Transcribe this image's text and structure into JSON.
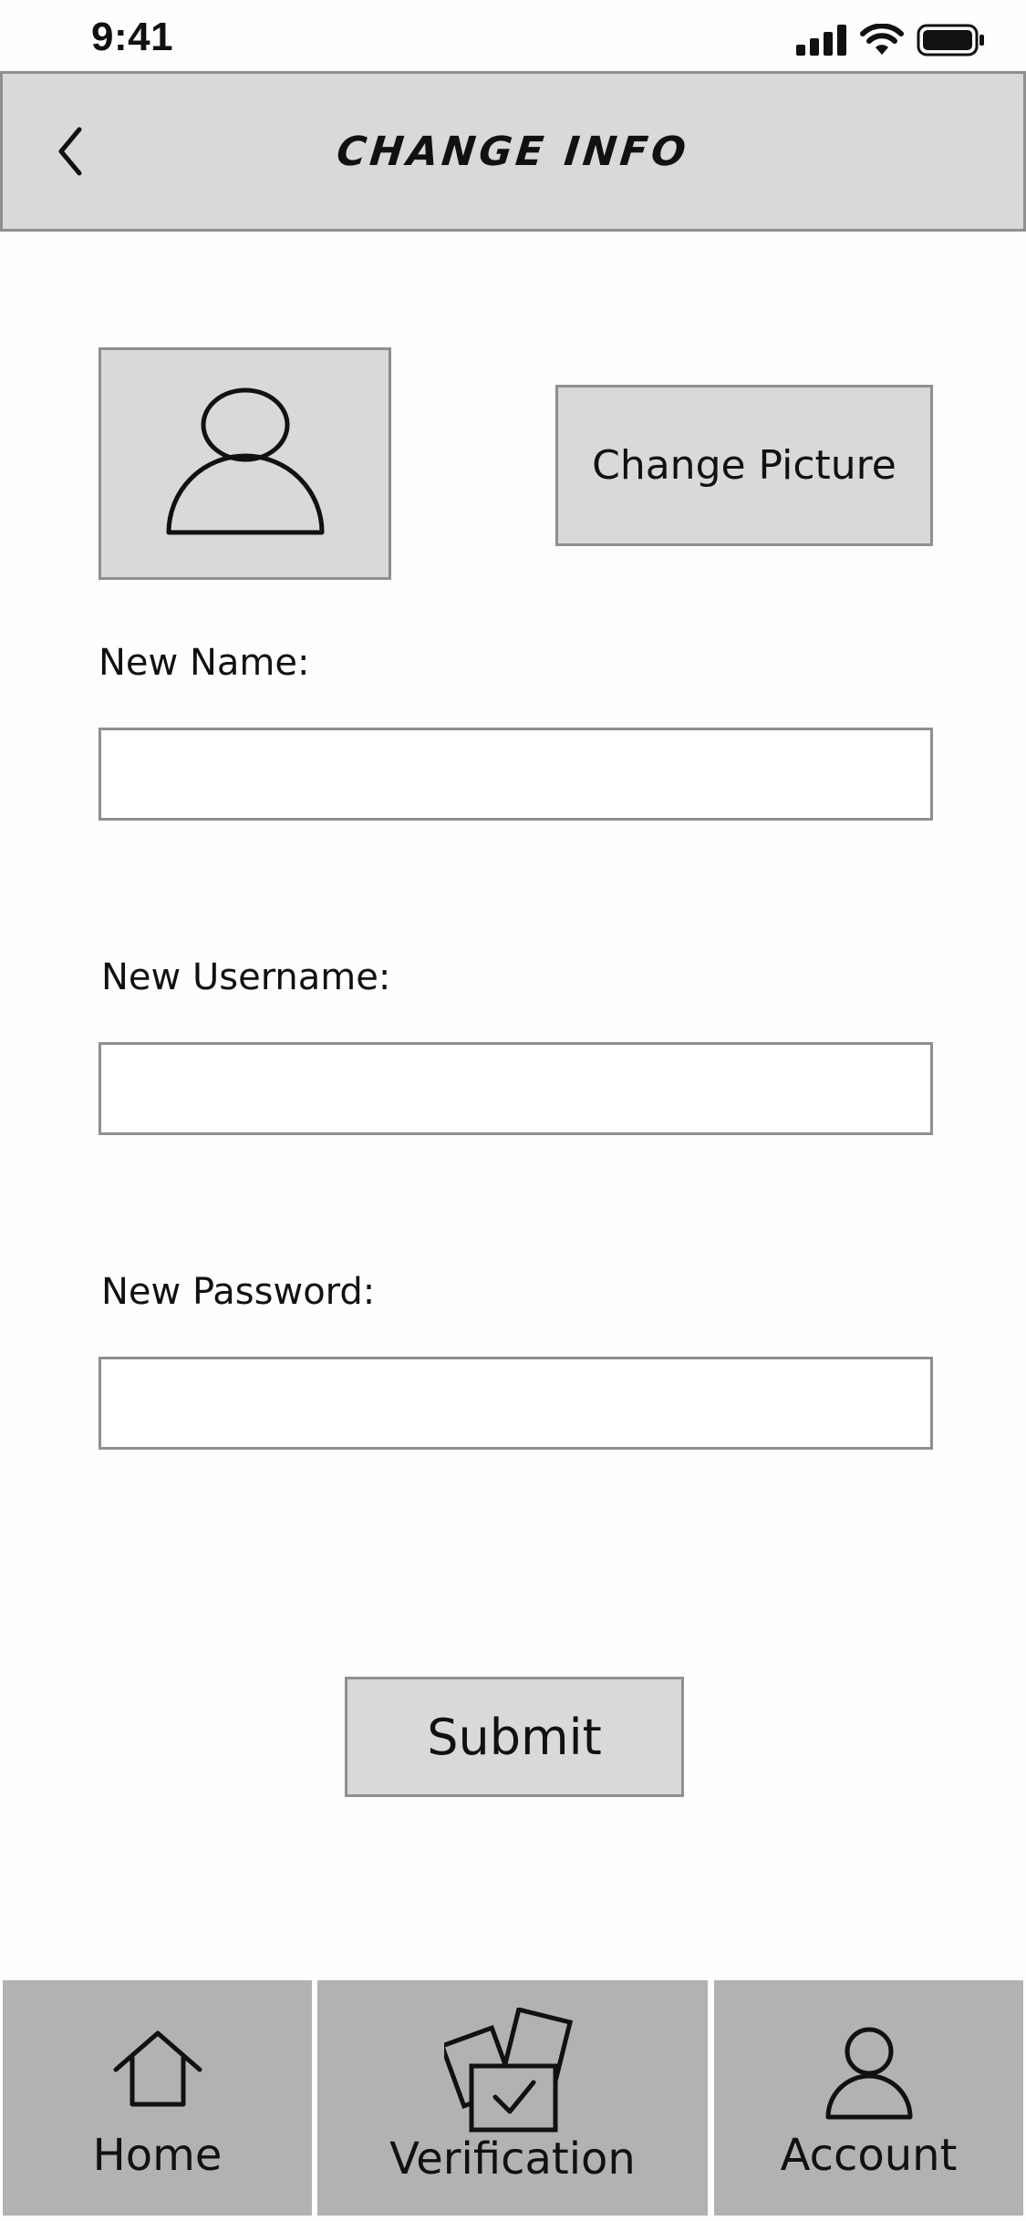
{
  "status_bar": {
    "time": "9:41"
  },
  "header": {
    "title": "CHANGE INFO"
  },
  "profile": {
    "change_picture_label": "Change Picture"
  },
  "form": {
    "name_label": "New Name:",
    "name_value": "",
    "username_label": "New Username:",
    "username_value": "",
    "password_label": "New Password:",
    "password_value": "",
    "submit_label": "Submit"
  },
  "bottom_nav": {
    "items": [
      {
        "label": "Home",
        "icon": "home-icon"
      },
      {
        "label": "Verification",
        "icon": "verification-icon"
      },
      {
        "label": "Account",
        "icon": "account-icon"
      }
    ]
  }
}
